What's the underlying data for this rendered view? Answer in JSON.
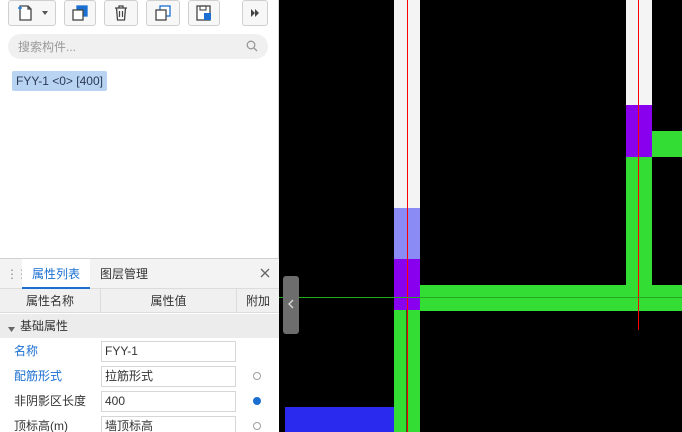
{
  "toolbar": {
    "buttons": [
      {
        "name": "new-component-button",
        "icon": "new-document-icon"
      },
      {
        "name": "copy-button",
        "icon": "copy-icon"
      },
      {
        "name": "delete-button",
        "icon": "trash-icon"
      },
      {
        "name": "copy-to-layer-button",
        "icon": "layers-copy-icon"
      },
      {
        "name": "save-template-button",
        "icon": "save-icon"
      },
      {
        "name": "more-button",
        "icon": "double-chevron-right-icon"
      }
    ]
  },
  "search": {
    "placeholder": "搜索构件..."
  },
  "component_list": {
    "selected_item": "FYY-1 <0> [400]"
  },
  "property_panel": {
    "tabs": [
      "属性列表",
      "图层管理"
    ],
    "active_tab": "属性列表",
    "columns": [
      "属性名称",
      "属性值",
      "附加"
    ],
    "group_label": "基础属性",
    "rows": [
      {
        "name": "名称",
        "value": "FYY-1",
        "name_color": "blue",
        "has_extra": false
      },
      {
        "name": "配筋形式",
        "value": "拉筋形式",
        "name_color": "blue",
        "has_extra": true,
        "extra_checked": false
      },
      {
        "name": "非阴影区长度",
        "value": "400",
        "name_color": "dark",
        "has_extra": true,
        "extra_checked": true
      },
      {
        "name": "顶标高(m)",
        "value": "墙顶标高",
        "name_color": "dark",
        "has_extra": true,
        "extra_checked": false
      }
    ]
  },
  "colors": {
    "accent": "#1a6fd1",
    "canvas_background": "#000000",
    "wall_green": "#33dd33",
    "column_purple": "#8800ee",
    "column_lavender": "#8b8bf5",
    "slab_blue": "#2a2aee",
    "axis_red": "#ff0000"
  }
}
